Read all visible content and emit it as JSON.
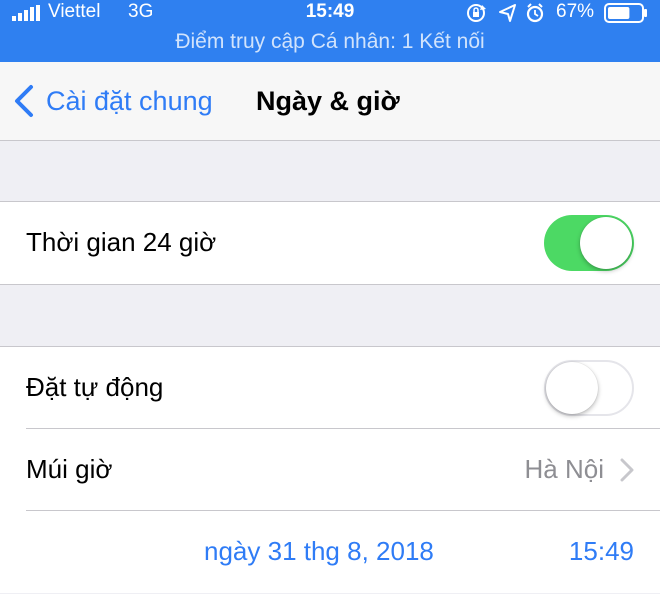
{
  "status_bar": {
    "carrier": "Viettel",
    "network": "3G",
    "time": "15:49",
    "battery_percent": "67%",
    "battery_level": 0.67,
    "icons": [
      "rotation-lock-icon",
      "location-arrow-icon",
      "alarm-icon"
    ]
  },
  "hotspot_banner": "Điểm truy cập Cá nhân: 1 Kết nối",
  "navbar": {
    "back_label": "Cài đặt chung",
    "title": "Ngày & giờ"
  },
  "settings": {
    "time_24h": {
      "label": "Thời gian 24 giờ",
      "enabled": true
    },
    "set_automatically": {
      "label": "Đặt tự động",
      "enabled": false
    },
    "time_zone": {
      "label": "Múi giờ",
      "value": "Hà Nội"
    },
    "date_time": {
      "date": "ngày 31 thg 8, 2018",
      "time": "15:49"
    }
  },
  "colors": {
    "status_bar_bg": "#2f80f0",
    "accent": "#2f7cf6",
    "switch_on": "#4cd964",
    "background": "#efeff4"
  }
}
